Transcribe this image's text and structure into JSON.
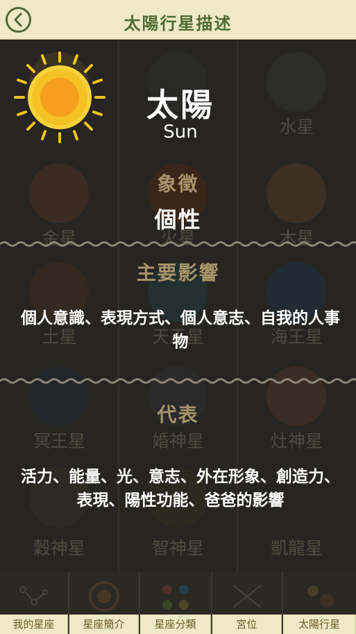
{
  "header": {
    "title": "太陽行星描述"
  },
  "grid": {
    "rows": [
      [
        "",
        "",
        "水星"
      ],
      [
        "金星",
        "火星",
        "木星"
      ],
      [
        "土星",
        "天王星",
        "海王星"
      ],
      [
        "冥王星",
        "婚神星",
        "灶神星"
      ],
      [
        "穀神星",
        "智神星",
        "凱龍星"
      ]
    ]
  },
  "planet": {
    "name_cn": "太陽",
    "name_en": "Sun",
    "symbol_label": "象徵",
    "symbol_value": "個性",
    "influence_label": "主要影響",
    "influence_text": "個人意識、表現方式、個人意志、自我的人事物",
    "represents_label": "代表",
    "represents_text": "活力、能量、光、意志、外在形象、創造力、表現、陽性功能、爸爸的影響"
  },
  "tabs": [
    "我的星座",
    "星座簡介",
    "星座分類",
    "宮位",
    "太陽行星"
  ],
  "colors": {
    "accent": "#4e6b33",
    "label": "#a8946a",
    "header_bg": "#efe9c5"
  }
}
